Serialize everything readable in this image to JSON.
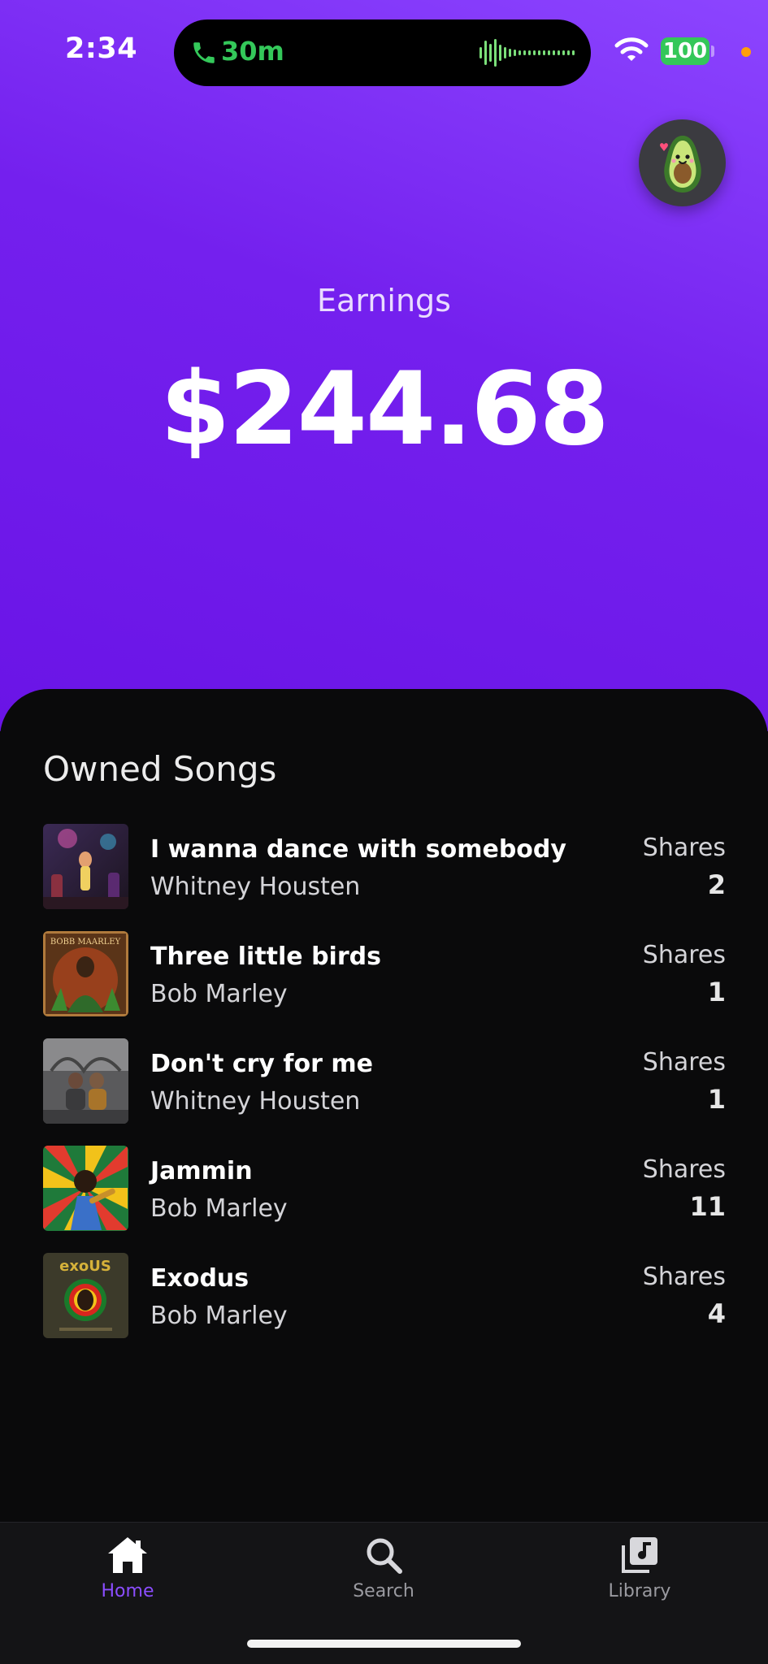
{
  "status_bar": {
    "time": "2:34",
    "call_duration": "30m",
    "battery": "100"
  },
  "profile": {
    "avatar_icon": "avocado-icon"
  },
  "earnings": {
    "label": "Earnings",
    "value": "$244.68"
  },
  "owned_songs": {
    "title": "Owned Songs",
    "shares_label": "Shares",
    "items": [
      {
        "title": "I wanna dance with somebody",
        "artist": "Whitney Housten",
        "shares": "2"
      },
      {
        "title": "Three little birds",
        "artist": "Bob Marley",
        "shares": "1"
      },
      {
        "title": "Don't cry for me",
        "artist": "Whitney Housten",
        "shares": "1"
      },
      {
        "title": "Jammin",
        "artist": "Bob Marley",
        "shares": "11"
      },
      {
        "title": "Exodus",
        "artist": "Bob Marley",
        "shares": "4"
      }
    ]
  },
  "cover_art": {
    "bob_marley_text": "BOBB MAARLEY",
    "exodus_text": "exoUS"
  },
  "tabs": [
    {
      "label": "Home",
      "icon": "home-icon",
      "active": true
    },
    {
      "label": "Search",
      "icon": "search-icon",
      "active": false
    },
    {
      "label": "Library",
      "icon": "library-icon",
      "active": false
    }
  ],
  "colors": {
    "accent": "#8b4dff",
    "hero_gradient_start": "#8c45ff",
    "hero_gradient_end": "#6a14e6",
    "background": "#0a0a0b",
    "call_green": "#34c85a",
    "battery_green": "#34c759"
  }
}
